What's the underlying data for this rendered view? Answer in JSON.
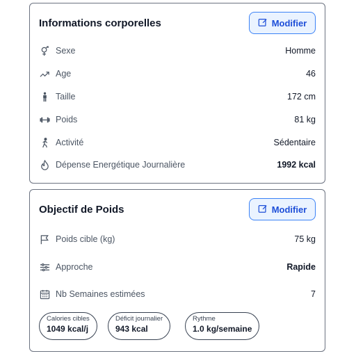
{
  "body_info": {
    "title": "Informations corporelles",
    "edit_label": "Modifier",
    "rows": [
      {
        "icon": "gender-icon",
        "label": "Sexe",
        "value": "Homme"
      },
      {
        "icon": "trend-icon",
        "label": "Age",
        "value": "46"
      },
      {
        "icon": "person-height-icon",
        "label": "Taille",
        "value": "172 cm"
      },
      {
        "icon": "dumbbell-icon",
        "label": "Poids",
        "value": "81 kg"
      },
      {
        "icon": "walking-icon",
        "label": "Activité",
        "value": "Sédentaire"
      },
      {
        "icon": "flame-icon",
        "label": "Dépense Energétique Journalière",
        "value": "1992 kcal"
      }
    ]
  },
  "weight_goal": {
    "title": "Objectif de Poids",
    "edit_label": "Modifier",
    "rows": [
      {
        "icon": "flag-icon",
        "label": "Poids cible (kg)",
        "value": "75 kg"
      },
      {
        "icon": "sliders-icon",
        "label": "Approche",
        "value": "Rapide"
      },
      {
        "icon": "calendar-icon",
        "label": "Nb Semaines estimées",
        "value": "7"
      }
    ],
    "chips": [
      {
        "label": "Calories cibles",
        "value": "1049 kcal/j"
      },
      {
        "label": "Déficit journalier",
        "value": "943 kcal"
      },
      {
        "label": "Rythme",
        "value": "1.0 kg/semaine"
      }
    ]
  },
  "colors": {
    "accent": "#1d4ed8",
    "button_bg": "#eaf3ff",
    "border": "#6b7280"
  }
}
